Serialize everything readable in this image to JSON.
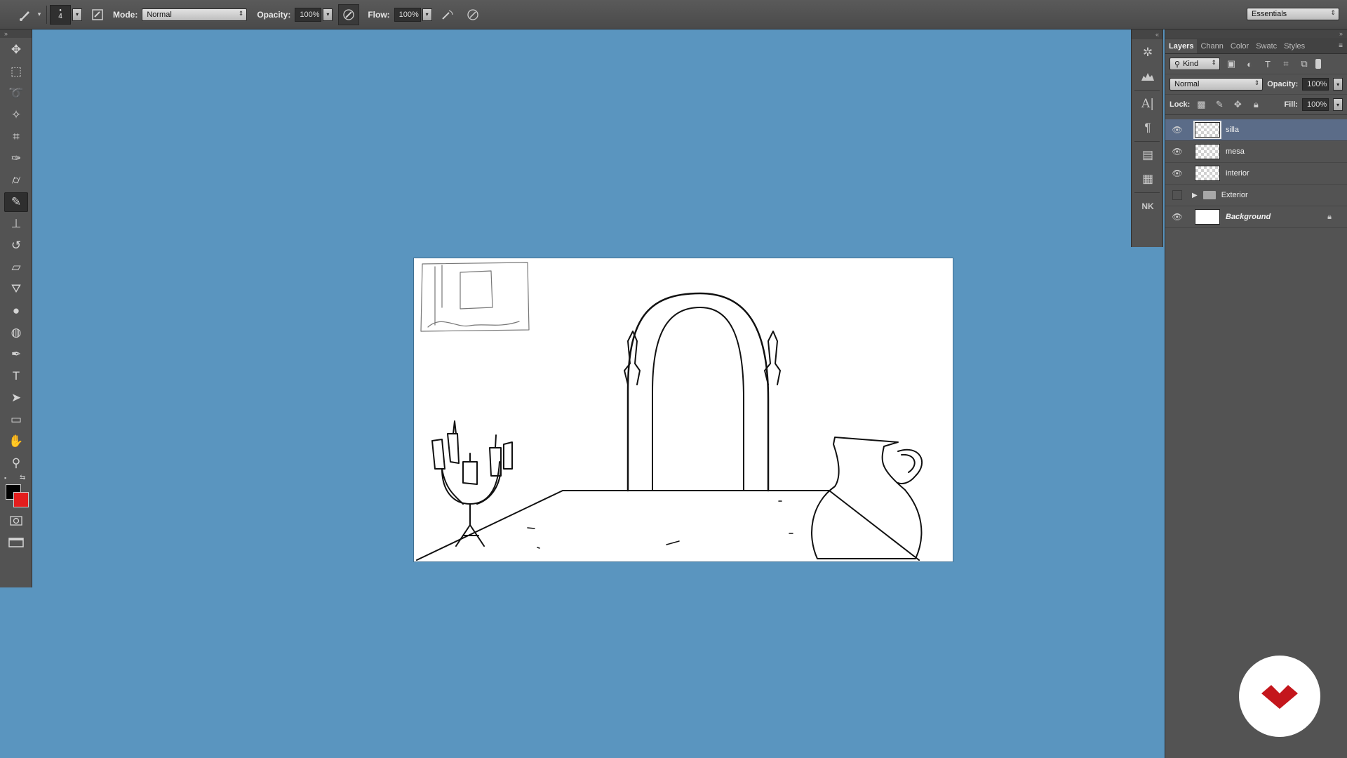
{
  "options_bar": {
    "brush_size": "4",
    "mode_label": "Mode:",
    "mode_value": "Normal",
    "opacity_label": "Opacity:",
    "opacity_value": "100%",
    "flow_label": "Flow:",
    "flow_value": "100%",
    "workspace": "Essentials"
  },
  "tools": [
    {
      "name": "move-tool",
      "icon": "move"
    },
    {
      "name": "marquee-tool",
      "icon": "marquee"
    },
    {
      "name": "lasso-tool",
      "icon": "lasso"
    },
    {
      "name": "magic-wand-tool",
      "icon": "wand"
    },
    {
      "name": "crop-tool",
      "icon": "crop"
    },
    {
      "name": "eyedropper-tool",
      "icon": "eyedropper"
    },
    {
      "name": "healing-brush-tool",
      "icon": "bandage"
    },
    {
      "name": "brush-tool",
      "icon": "brush",
      "active": true
    },
    {
      "name": "clone-stamp-tool",
      "icon": "stamp"
    },
    {
      "name": "history-brush-tool",
      "icon": "history-brush"
    },
    {
      "name": "eraser-tool",
      "icon": "eraser"
    },
    {
      "name": "paint-bucket-tool",
      "icon": "bucket"
    },
    {
      "name": "blur-tool",
      "icon": "drop"
    },
    {
      "name": "dodge-tool",
      "icon": "dodge"
    },
    {
      "name": "pen-tool",
      "icon": "pen"
    },
    {
      "name": "type-tool",
      "icon": "type"
    },
    {
      "name": "path-selection-tool",
      "icon": "arrow"
    },
    {
      "name": "rectangle-tool",
      "icon": "rectangle"
    },
    {
      "name": "hand-tool",
      "icon": "hand"
    },
    {
      "name": "zoom-tool",
      "icon": "zoom"
    }
  ],
  "colors": {
    "foreground": "#000000",
    "background": "#e41e1e",
    "workspace_bg": "#5a95bf",
    "selected_layer": "#5b6c88"
  },
  "layers_panel": {
    "tabs": [
      "Layers",
      "Chann",
      "Color",
      "Swatc",
      "Styles"
    ],
    "filter_label": "Kind",
    "blend_mode": "Normal",
    "opacity_label": "Opacity:",
    "opacity_value": "100%",
    "lock_label": "Lock:",
    "fill_label": "Fill:",
    "fill_value": "100%",
    "layers": [
      {
        "name": "silla",
        "visible": true,
        "selected": true,
        "type": "transparent"
      },
      {
        "name": "mesa",
        "visible": true,
        "type": "transparent"
      },
      {
        "name": "interior",
        "visible": true,
        "type": "transparent"
      },
      {
        "name": "Exterior",
        "visible": false,
        "type": "group"
      },
      {
        "name": "Background",
        "visible": true,
        "type": "white",
        "locked": true
      }
    ]
  }
}
